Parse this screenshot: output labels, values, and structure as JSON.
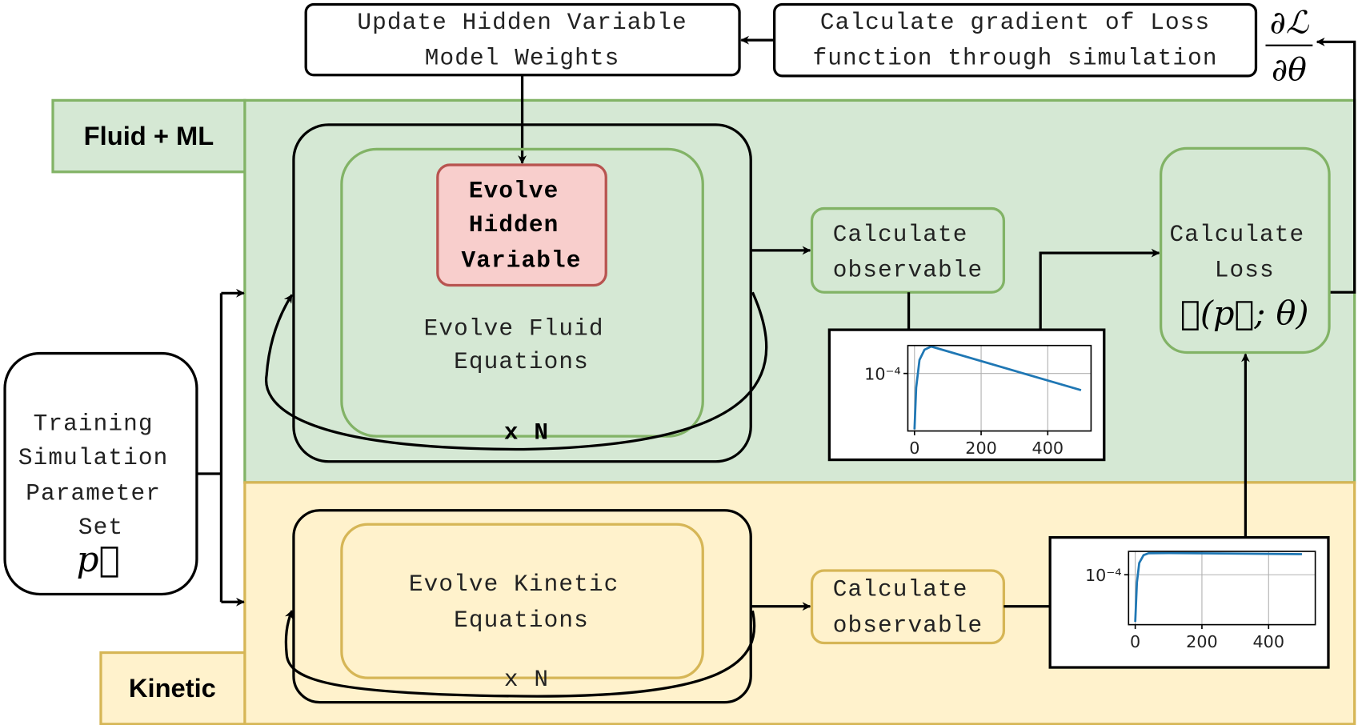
{
  "top": {
    "update_box": [
      "Update Hidden Variable",
      "Model Weights"
    ],
    "gradient_box": [
      "Calculate gradient of Loss",
      "function through simulation"
    ],
    "gradient_symbol_num": "∂ℒ",
    "gradient_symbol_den": "∂θ"
  },
  "regions": {
    "fluid_label": "Fluid + ML",
    "kinetic_label": "Kinetic",
    "fluid_color": "#d5e8d4",
    "fluid_stroke": "#82b366",
    "kinetic_color": "#fff2cc",
    "kinetic_stroke": "#d6b656",
    "hidden_color": "#f8cecc",
    "hidden_stroke": "#b85450"
  },
  "input": {
    "lines": [
      "Training",
      "Simulation",
      "Parameter",
      "Set"
    ],
    "symbol": "p⃗"
  },
  "fluid": {
    "hidden_box": [
      "Evolve",
      "Hidden",
      "Variable"
    ],
    "equations": [
      "Evolve Fluid",
      "Equations"
    ],
    "loop_label": "x N",
    "observable": [
      "Calculate",
      "observable"
    ]
  },
  "kinetic": {
    "equations": [
      "Evolve Kinetic",
      "Equations"
    ],
    "loop_label": "x N",
    "observable": [
      "Calculate",
      "observable"
    ]
  },
  "loss": {
    "lines": [
      "Calculate",
      "Loss"
    ],
    "formula": "ℒ(p⃗; θ)"
  },
  "chart_data": [
    {
      "type": "line",
      "xticks": [
        0,
        200,
        400
      ],
      "xtick_labels": [
        "0",
        "200",
        "400"
      ],
      "ytick_label": "10⁻⁴",
      "yscale": "log",
      "xlim": [
        -20,
        530
      ],
      "ylim": [
        2.4e-05,
        0.0002
      ],
      "grid": true,
      "line_color": "#1f77b4",
      "x": [
        0,
        5,
        15,
        30,
        50,
        500
      ],
      "y": [
        2.5e-05,
        7e-05,
        0.00014,
        0.00018,
        0.000195,
        6.6e-05
      ]
    },
    {
      "type": "line",
      "xticks": [
        0,
        200,
        400
      ],
      "xtick_labels": [
        "0",
        "200",
        "400"
      ],
      "ytick_label": "10⁻⁴",
      "yscale": "log",
      "xlim": [
        -20,
        540
      ],
      "ylim": [
        2.4e-05,
        0.000195
      ],
      "grid": true,
      "line_color": "#1f77b4",
      "x": [
        0,
        5,
        12,
        25,
        40,
        100,
        500
      ],
      "y": [
        2.6e-05,
        8e-05,
        0.00014,
        0.000175,
        0.000185,
        0.000186,
        0.00018
      ]
    }
  ]
}
